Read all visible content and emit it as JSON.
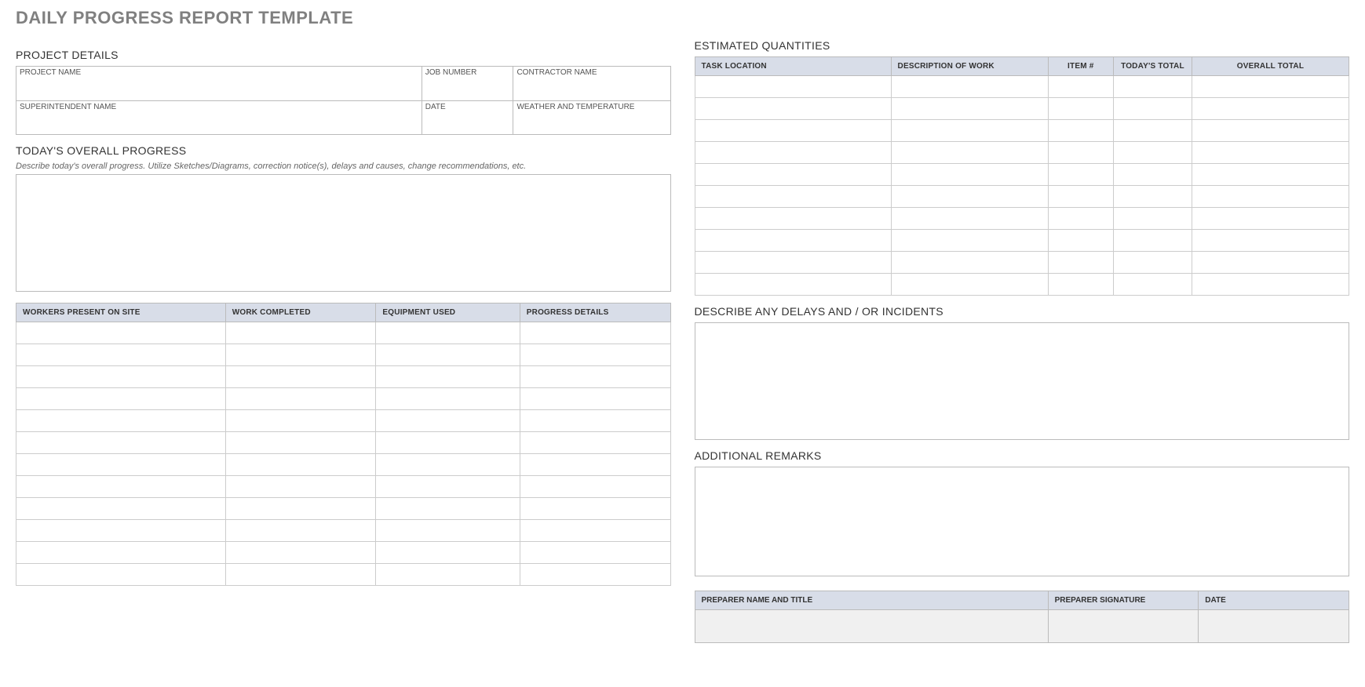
{
  "title": "DAILY PROGRESS REPORT TEMPLATE",
  "left": {
    "project_details": {
      "heading": "PROJECT DETAILS",
      "row1": {
        "project_name_lbl": "PROJECT NAME",
        "job_number_lbl": "JOB NUMBER",
        "contractor_name_lbl": "CONTRACTOR NAME",
        "project_name": "",
        "job_number": "",
        "contractor_name": ""
      },
      "row2": {
        "superintendent_lbl": "SUPERINTENDENT NAME",
        "date_lbl": "DATE",
        "weather_lbl": "WEATHER AND TEMPERATURE",
        "superintendent": "",
        "date": "",
        "weather": ""
      }
    },
    "overall_progress": {
      "heading": "TODAY'S OVERALL PROGRESS",
      "hint": "Describe today's overall progress.  Utilize Sketches/Diagrams, correction notice(s), delays and causes, change recommendations, etc.",
      "text": ""
    },
    "work_table": {
      "headers": [
        "WORKERS PRESENT ON SITE",
        "WORK COMPLETED",
        "EQUIPMENT USED",
        "PROGRESS DETAILS"
      ],
      "rows": [
        [
          "",
          "",
          "",
          ""
        ],
        [
          "",
          "",
          "",
          ""
        ],
        [
          "",
          "",
          "",
          ""
        ],
        [
          "",
          "",
          "",
          ""
        ],
        [
          "",
          "",
          "",
          ""
        ],
        [
          "",
          "",
          "",
          ""
        ],
        [
          "",
          "",
          "",
          ""
        ],
        [
          "",
          "",
          "",
          ""
        ],
        [
          "",
          "",
          "",
          ""
        ],
        [
          "",
          "",
          "",
          ""
        ],
        [
          "",
          "",
          "",
          ""
        ],
        [
          "",
          "",
          "",
          ""
        ]
      ]
    }
  },
  "right": {
    "quantities": {
      "heading": "ESTIMATED QUANTITIES",
      "headers": [
        "TASK LOCATION",
        "DESCRIPTION OF WORK",
        "ITEM #",
        "TODAY'S TOTAL",
        "OVERALL TOTAL"
      ],
      "rows": [
        [
          "",
          "",
          "",
          "",
          ""
        ],
        [
          "",
          "",
          "",
          "",
          ""
        ],
        [
          "",
          "",
          "",
          "",
          ""
        ],
        [
          "",
          "",
          "",
          "",
          ""
        ],
        [
          "",
          "",
          "",
          "",
          ""
        ],
        [
          "",
          "",
          "",
          "",
          ""
        ],
        [
          "",
          "",
          "",
          "",
          ""
        ],
        [
          "",
          "",
          "",
          "",
          ""
        ],
        [
          "",
          "",
          "",
          "",
          ""
        ],
        [
          "",
          "",
          "",
          "",
          ""
        ]
      ]
    },
    "delays": {
      "heading": "DESCRIBE ANY DELAYS AND / OR INCIDENTS",
      "text": ""
    },
    "remarks": {
      "heading": "ADDITIONAL REMARKS",
      "text": ""
    },
    "signature": {
      "headers": [
        "PREPARER NAME AND TITLE",
        "PREPARER SIGNATURE",
        "DATE"
      ],
      "name": "",
      "sig": "",
      "date": ""
    }
  }
}
